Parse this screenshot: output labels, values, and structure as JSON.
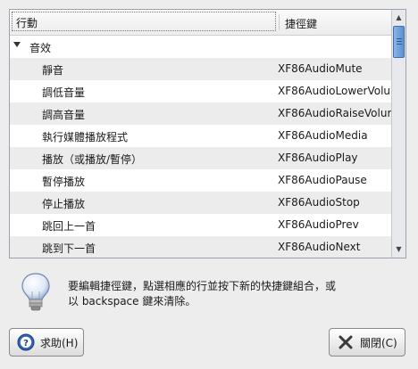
{
  "tree": {
    "columns": {
      "action": "行動",
      "shortcut": "捷徑鍵"
    },
    "category": {
      "label": "音效"
    },
    "rows": [
      {
        "label": "靜音",
        "key": "XF86AudioMute"
      },
      {
        "label": "調低音量",
        "key": "XF86AudioLowerVolur"
      },
      {
        "label": "調高音量",
        "key": "XF86AudioRaiseVolur"
      },
      {
        "label": "執行媒體播放程式",
        "key": "XF86AudioMedia"
      },
      {
        "label": "播放（或播放/暫停）",
        "key": "XF86AudioPlay"
      },
      {
        "label": "暫停播放",
        "key": "XF86AudioPause"
      },
      {
        "label": "停止播放",
        "key": "XF86AudioStop"
      },
      {
        "label": "跳回上一首",
        "key": "XF86AudioPrev"
      },
      {
        "label": "跳到下一首",
        "key": "XF86AudioNext"
      }
    ]
  },
  "info": {
    "icon": "lightbulb-icon",
    "line1": "要編輯捷徑鍵，點選相應的行並按下新的快捷鍵組合，或",
    "line2": "以 backspace 鍵來清除。"
  },
  "buttons": {
    "help": "求助(H)",
    "close": "關閉(C)"
  },
  "colors": {
    "scroll_thumb": "#5a8fd2",
    "row_alt": "#ececec"
  }
}
